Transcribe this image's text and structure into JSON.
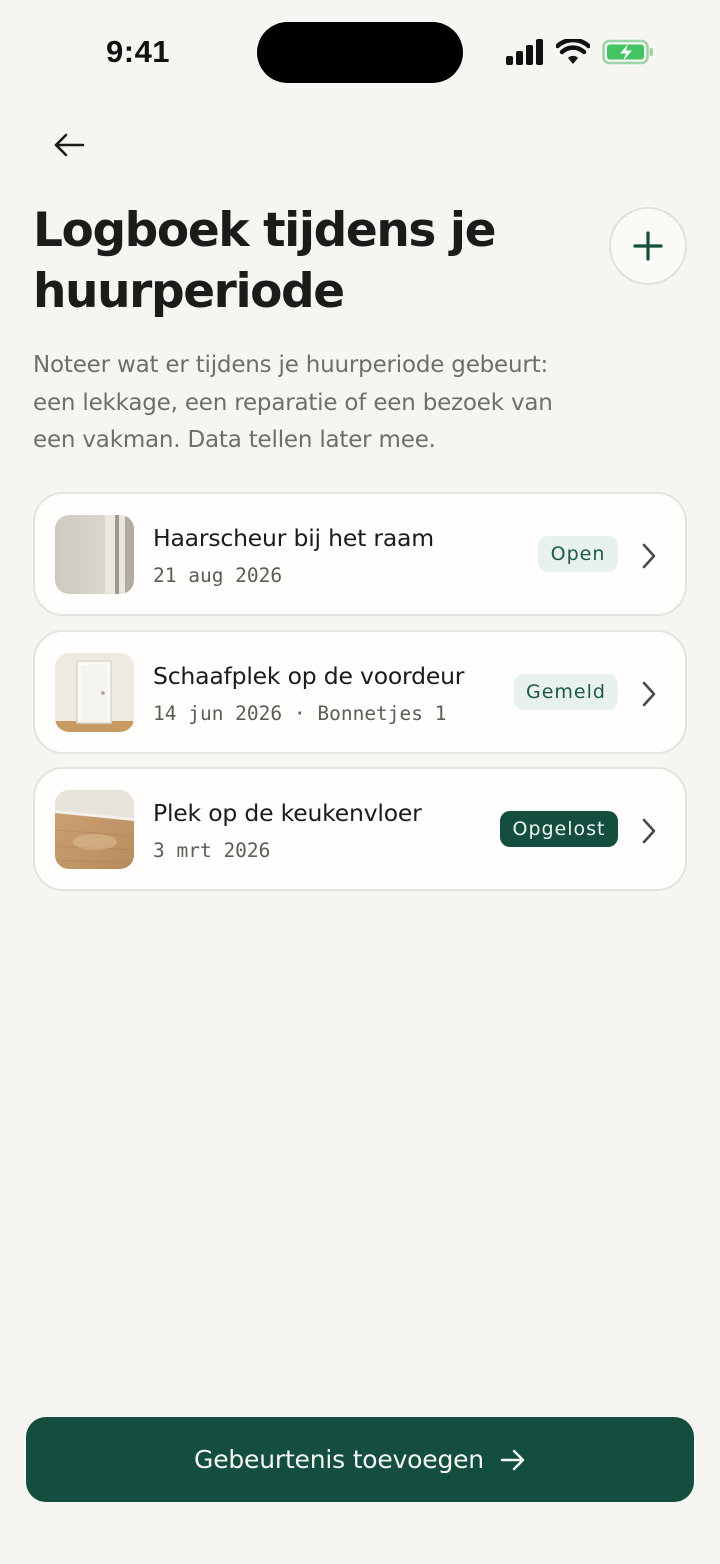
{
  "status_bar": {
    "time": "9:41"
  },
  "header": {
    "title": "Logboek tijdens je huurperiode",
    "intro": "Noteer wat er tijdens je huurperiode gebeurt: een lekkage, een reparatie of een bezoek van een vakman. Data tellen later mee."
  },
  "entries": [
    {
      "title": "Haarscheur bij het raam",
      "meta": "21 aug 2026",
      "status": "Open",
      "status_style": "soft"
    },
    {
      "title": "Schaafplek op de voordeur",
      "meta": "14 jun 2026 · Bonnetjes 1",
      "status": "Gemeld",
      "status_style": "soft"
    },
    {
      "title": "Plek op de keukenvloer",
      "meta": "3 mrt 2026",
      "status": "Opgelost",
      "status_style": "solid"
    }
  ],
  "cta": {
    "label": "Gebeurtenis toevoegen"
  },
  "colors": {
    "accent": "#144e3f",
    "background": "#f6f5f1",
    "soft_badge": "#e9f1ed"
  }
}
